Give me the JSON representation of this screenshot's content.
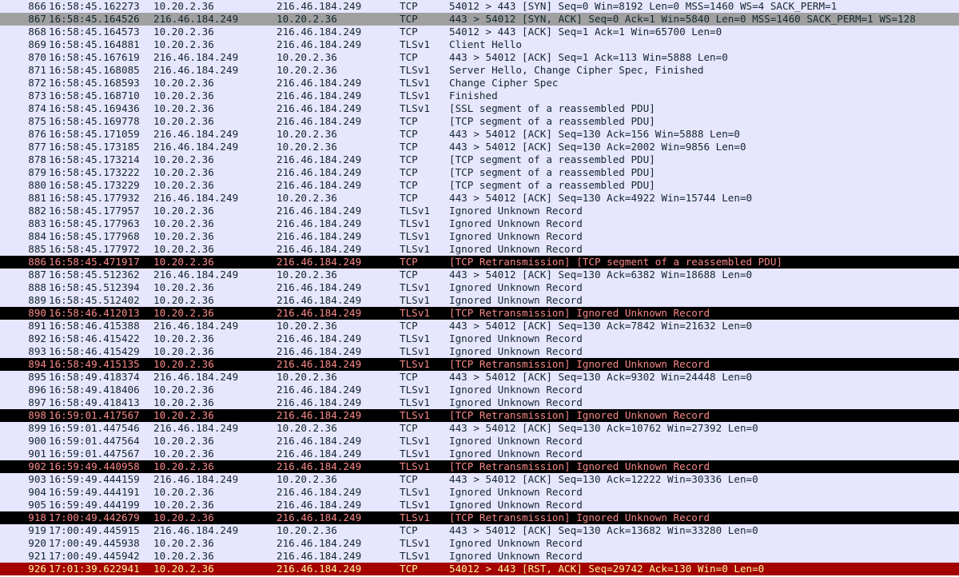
{
  "packets": [
    {
      "no": "866",
      "time": "16:58:45.162273",
      "src": "10.20.2.36",
      "dst": "216.46.184.249",
      "proto": "TCP",
      "info": "54012 > 443 [SYN] Seq=0 Win=8192 Len=0 MSS=1460 WS=4 SACK_PERM=1",
      "style": "tcp"
    },
    {
      "no": "867",
      "time": "16:58:45.164526",
      "src": "216.46.184.249",
      "dst": "10.20.2.36",
      "proto": "TCP",
      "info": "443 > 54012 [SYN, ACK] Seq=0 Ack=1 Win=5840 Len=0 MSS=1460 SACK_PERM=1 WS=128",
      "style": "syn"
    },
    {
      "no": "868",
      "time": "16:58:45.164573",
      "src": "10.20.2.36",
      "dst": "216.46.184.249",
      "proto": "TCP",
      "info": "54012 > 443 [ACK] Seq=1 Ack=1 Win=65700 Len=0",
      "style": "tcp"
    },
    {
      "no": "869",
      "time": "16:58:45.164881",
      "src": "10.20.2.36",
      "dst": "216.46.184.249",
      "proto": "TLSv1",
      "info": "Client Hello",
      "style": "tls"
    },
    {
      "no": "870",
      "time": "16:58:45.167619",
      "src": "216.46.184.249",
      "dst": "10.20.2.36",
      "proto": "TCP",
      "info": "443 > 54012 [ACK] Seq=1 Ack=113 Win=5888 Len=0",
      "style": "tcp"
    },
    {
      "no": "871",
      "time": "16:58:45.168085",
      "src": "216.46.184.249",
      "dst": "10.20.2.36",
      "proto": "TLSv1",
      "info": "Server Hello, Change Cipher Spec, Finished",
      "style": "tls"
    },
    {
      "no": "872",
      "time": "16:58:45.168593",
      "src": "10.20.2.36",
      "dst": "216.46.184.249",
      "proto": "TLSv1",
      "info": "Change Cipher Spec",
      "style": "tls"
    },
    {
      "no": "873",
      "time": "16:58:45.168710",
      "src": "10.20.2.36",
      "dst": "216.46.184.249",
      "proto": "TLSv1",
      "info": "Finished",
      "style": "tls"
    },
    {
      "no": "874",
      "time": "16:58:45.169436",
      "src": "10.20.2.36",
      "dst": "216.46.184.249",
      "proto": "TLSv1",
      "info": "[SSL segment of a reassembled PDU]",
      "style": "tls"
    },
    {
      "no": "875",
      "time": "16:58:45.169778",
      "src": "10.20.2.36",
      "dst": "216.46.184.249",
      "proto": "TCP",
      "info": "[TCP segment of a reassembled PDU]",
      "style": "tcp"
    },
    {
      "no": "876",
      "time": "16:58:45.171059",
      "src": "216.46.184.249",
      "dst": "10.20.2.36",
      "proto": "TCP",
      "info": "443 > 54012 [ACK] Seq=130 Ack=156 Win=5888 Len=0",
      "style": "tcp"
    },
    {
      "no": "877",
      "time": "16:58:45.173185",
      "src": "216.46.184.249",
      "dst": "10.20.2.36",
      "proto": "TCP",
      "info": "443 > 54012 [ACK] Seq=130 Ack=2002 Win=9856 Len=0",
      "style": "tcp"
    },
    {
      "no": "878",
      "time": "16:58:45.173214",
      "src": "10.20.2.36",
      "dst": "216.46.184.249",
      "proto": "TCP",
      "info": "[TCP segment of a reassembled PDU]",
      "style": "tcp"
    },
    {
      "no": "879",
      "time": "16:58:45.173222",
      "src": "10.20.2.36",
      "dst": "216.46.184.249",
      "proto": "TCP",
      "info": "[TCP segment of a reassembled PDU]",
      "style": "tcp"
    },
    {
      "no": "880",
      "time": "16:58:45.173229",
      "src": "10.20.2.36",
      "dst": "216.46.184.249",
      "proto": "TCP",
      "info": "[TCP segment of a reassembled PDU]",
      "style": "tcp"
    },
    {
      "no": "881",
      "time": "16:58:45.177932",
      "src": "216.46.184.249",
      "dst": "10.20.2.36",
      "proto": "TCP",
      "info": "443 > 54012 [ACK] Seq=130 Ack=4922 Win=15744 Len=0",
      "style": "tcp"
    },
    {
      "no": "882",
      "time": "16:58:45.177957",
      "src": "10.20.2.36",
      "dst": "216.46.184.249",
      "proto": "TLSv1",
      "info": "Ignored Unknown Record",
      "style": "tls"
    },
    {
      "no": "883",
      "time": "16:58:45.177963",
      "src": "10.20.2.36",
      "dst": "216.46.184.249",
      "proto": "TLSv1",
      "info": "Ignored Unknown Record",
      "style": "tls"
    },
    {
      "no": "884",
      "time": "16:58:45.177968",
      "src": "10.20.2.36",
      "dst": "216.46.184.249",
      "proto": "TLSv1",
      "info": "Ignored Unknown Record",
      "style": "tls"
    },
    {
      "no": "885",
      "time": "16:58:45.177972",
      "src": "10.20.2.36",
      "dst": "216.46.184.249",
      "proto": "TLSv1",
      "info": "Ignored Unknown Record",
      "style": "tls"
    },
    {
      "no": "886",
      "time": "16:58:45.471917",
      "src": "10.20.2.36",
      "dst": "216.46.184.249",
      "proto": "TCP",
      "info": "[TCP Retransmission] [TCP segment of a reassembled PDU]",
      "style": "bad"
    },
    {
      "no": "887",
      "time": "16:58:45.512362",
      "src": "216.46.184.249",
      "dst": "10.20.2.36",
      "proto": "TCP",
      "info": "443 > 54012 [ACK] Seq=130 Ack=6382 Win=18688 Len=0",
      "style": "tcp"
    },
    {
      "no": "888",
      "time": "16:58:45.512394",
      "src": "10.20.2.36",
      "dst": "216.46.184.249",
      "proto": "TLSv1",
      "info": "Ignored Unknown Record",
      "style": "tls"
    },
    {
      "no": "889",
      "time": "16:58:45.512402",
      "src": "10.20.2.36",
      "dst": "216.46.184.249",
      "proto": "TLSv1",
      "info": "Ignored Unknown Record",
      "style": "tls"
    },
    {
      "no": "890",
      "time": "16:58:46.412013",
      "src": "10.20.2.36",
      "dst": "216.46.184.249",
      "proto": "TLSv1",
      "info": "[TCP Retransmission] Ignored Unknown Record",
      "style": "bad"
    },
    {
      "no": "891",
      "time": "16:58:46.415388",
      "src": "216.46.184.249",
      "dst": "10.20.2.36",
      "proto": "TCP",
      "info": "443 > 54012 [ACK] Seq=130 Ack=7842 Win=21632 Len=0",
      "style": "tcp"
    },
    {
      "no": "892",
      "time": "16:58:46.415422",
      "src": "10.20.2.36",
      "dst": "216.46.184.249",
      "proto": "TLSv1",
      "info": "Ignored Unknown Record",
      "style": "tls"
    },
    {
      "no": "893",
      "time": "16:58:46.415429",
      "src": "10.20.2.36",
      "dst": "216.46.184.249",
      "proto": "TLSv1",
      "info": "Ignored Unknown Record",
      "style": "tls"
    },
    {
      "no": "894",
      "time": "16:58:49.415135",
      "src": "10.20.2.36",
      "dst": "216.46.184.249",
      "proto": "TLSv1",
      "info": "[TCP Retransmission] Ignored Unknown Record",
      "style": "bad"
    },
    {
      "no": "895",
      "time": "16:58:49.418374",
      "src": "216.46.184.249",
      "dst": "10.20.2.36",
      "proto": "TCP",
      "info": "443 > 54012 [ACK] Seq=130 Ack=9302 Win=24448 Len=0",
      "style": "tcp"
    },
    {
      "no": "896",
      "time": "16:58:49.418406",
      "src": "10.20.2.36",
      "dst": "216.46.184.249",
      "proto": "TLSv1",
      "info": "Ignored Unknown Record",
      "style": "tls"
    },
    {
      "no": "897",
      "time": "16:58:49.418413",
      "src": "10.20.2.36",
      "dst": "216.46.184.249",
      "proto": "TLSv1",
      "info": "Ignored Unknown Record",
      "style": "tls"
    },
    {
      "no": "898",
      "time": "16:59:01.417567",
      "src": "10.20.2.36",
      "dst": "216.46.184.249",
      "proto": "TLSv1",
      "info": "[TCP Retransmission] Ignored Unknown Record",
      "style": "bad"
    },
    {
      "no": "899",
      "time": "16:59:01.447546",
      "src": "216.46.184.249",
      "dst": "10.20.2.36",
      "proto": "TCP",
      "info": "443 > 54012 [ACK] Seq=130 Ack=10762 Win=27392 Len=0",
      "style": "tcp"
    },
    {
      "no": "900",
      "time": "16:59:01.447564",
      "src": "10.20.2.36",
      "dst": "216.46.184.249",
      "proto": "TLSv1",
      "info": "Ignored Unknown Record",
      "style": "tls"
    },
    {
      "no": "901",
      "time": "16:59:01.447567",
      "src": "10.20.2.36",
      "dst": "216.46.184.249",
      "proto": "TLSv1",
      "info": "Ignored Unknown Record",
      "style": "tls"
    },
    {
      "no": "902",
      "time": "16:59:49.440958",
      "src": "10.20.2.36",
      "dst": "216.46.184.249",
      "proto": "TLSv1",
      "info": "[TCP Retransmission] Ignored Unknown Record",
      "style": "bad"
    },
    {
      "no": "903",
      "time": "16:59:49.444159",
      "src": "216.46.184.249",
      "dst": "10.20.2.36",
      "proto": "TCP",
      "info": "443 > 54012 [ACK] Seq=130 Ack=12222 Win=30336 Len=0",
      "style": "tcp"
    },
    {
      "no": "904",
      "time": "16:59:49.444191",
      "src": "10.20.2.36",
      "dst": "216.46.184.249",
      "proto": "TLSv1",
      "info": "Ignored Unknown Record",
      "style": "tls"
    },
    {
      "no": "905",
      "time": "16:59:49.444199",
      "src": "10.20.2.36",
      "dst": "216.46.184.249",
      "proto": "TLSv1",
      "info": "Ignored Unknown Record",
      "style": "tls"
    },
    {
      "no": "918",
      "time": "17:00:49.442679",
      "src": "10.20.2.36",
      "dst": "216.46.184.249",
      "proto": "TLSv1",
      "info": "[TCP Retransmission] Ignored Unknown Record",
      "style": "bad"
    },
    {
      "no": "919",
      "time": "17:00:49.445915",
      "src": "216.46.184.249",
      "dst": "10.20.2.36",
      "proto": "TCP",
      "info": "443 > 54012 [ACK] Seq=130 Ack=13682 Win=33280 Len=0",
      "style": "tcp"
    },
    {
      "no": "920",
      "time": "17:00:49.445938",
      "src": "10.20.2.36",
      "dst": "216.46.184.249",
      "proto": "TLSv1",
      "info": "Ignored Unknown Record",
      "style": "tls"
    },
    {
      "no": "921",
      "time": "17:00:49.445942",
      "src": "10.20.2.36",
      "dst": "216.46.184.249",
      "proto": "TLSv1",
      "info": "Ignored Unknown Record",
      "style": "tls"
    },
    {
      "no": "926",
      "time": "17:01:39.622941",
      "src": "10.20.2.36",
      "dst": "216.46.184.249",
      "proto": "TCP",
      "info": "54012 > 443 [RST, ACK] Seq=29742 Ack=130 Win=0 Len=0",
      "style": "rst"
    }
  ]
}
